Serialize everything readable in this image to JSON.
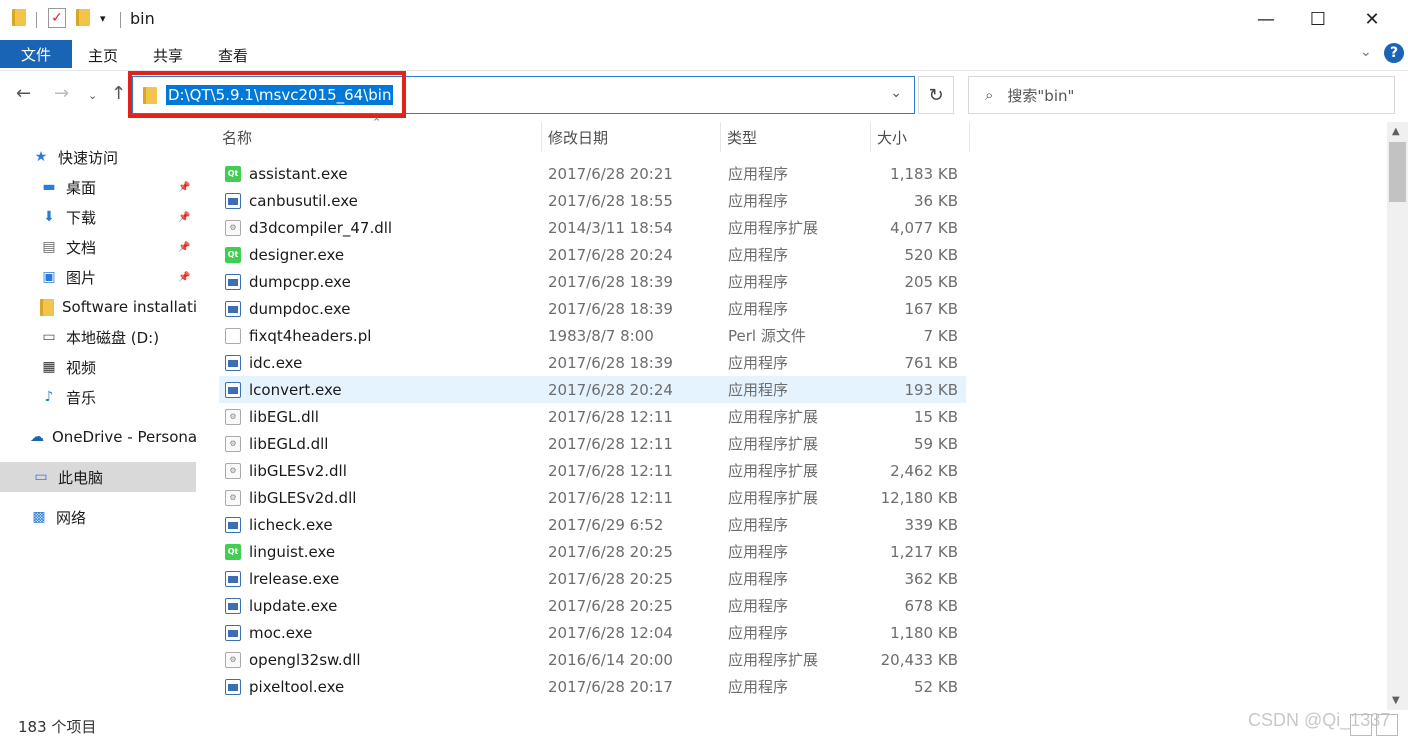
{
  "window": {
    "title": "bin",
    "minimize": "—",
    "maximize": "☐",
    "close": "✕"
  },
  "ribbon": {
    "tabs": [
      "文件",
      "主页",
      "共享",
      "查看"
    ],
    "help": "?"
  },
  "address": {
    "path": "D:\\QT\\5.9.1\\msvc2015_64\\bin",
    "search_placeholder": "搜索\"bin\""
  },
  "sidebar": {
    "items": [
      {
        "label": "快速访问",
        "icon": "star-icon"
      },
      {
        "label": "桌面",
        "icon": "desktop-icon",
        "pinned": true
      },
      {
        "label": "下载",
        "icon": "download-icon",
        "pinned": true
      },
      {
        "label": "文档",
        "icon": "document-icon",
        "pinned": true
      },
      {
        "label": "图片",
        "icon": "picture-icon",
        "pinned": true
      },
      {
        "label": "Software installati",
        "icon": "folder-icon"
      },
      {
        "label": "本地磁盘 (D:)",
        "icon": "drive-icon"
      },
      {
        "label": "视频",
        "icon": "video-icon"
      },
      {
        "label": "音乐",
        "icon": "music-icon"
      },
      {
        "label": "OneDrive - Persona",
        "icon": "cloud-icon"
      },
      {
        "label": "此电脑",
        "icon": "computer-icon",
        "selected": true
      },
      {
        "label": "网络",
        "icon": "network-icon"
      }
    ]
  },
  "columns": {
    "name": "名称",
    "date": "修改日期",
    "type": "类型",
    "size": "大小"
  },
  "files": [
    {
      "name": "assistant.exe",
      "date": "2017/6/28 20:21",
      "type": "应用程序",
      "size": "1,183 KB",
      "icon": "qt"
    },
    {
      "name": "canbusutil.exe",
      "date": "2017/6/28 18:55",
      "type": "应用程序",
      "size": "36 KB",
      "icon": "exe"
    },
    {
      "name": "d3dcompiler_47.dll",
      "date": "2014/3/11 18:54",
      "type": "应用程序扩展",
      "size": "4,077 KB",
      "icon": "dll"
    },
    {
      "name": "designer.exe",
      "date": "2017/6/28 20:24",
      "type": "应用程序",
      "size": "520 KB",
      "icon": "qt"
    },
    {
      "name": "dumpcpp.exe",
      "date": "2017/6/28 18:39",
      "type": "应用程序",
      "size": "205 KB",
      "icon": "exe"
    },
    {
      "name": "dumpdoc.exe",
      "date": "2017/6/28 18:39",
      "type": "应用程序",
      "size": "167 KB",
      "icon": "exe"
    },
    {
      "name": "fixqt4headers.pl",
      "date": "1983/8/7 8:00",
      "type": "Perl 源文件",
      "size": "7 KB",
      "icon": "pl"
    },
    {
      "name": "idc.exe",
      "date": "2017/6/28 18:39",
      "type": "应用程序",
      "size": "761 KB",
      "icon": "exe"
    },
    {
      "name": "lconvert.exe",
      "date": "2017/6/28 20:24",
      "type": "应用程序",
      "size": "193 KB",
      "icon": "exe",
      "highlight": true
    },
    {
      "name": "libEGL.dll",
      "date": "2017/6/28 12:11",
      "type": "应用程序扩展",
      "size": "15 KB",
      "icon": "dll"
    },
    {
      "name": "libEGLd.dll",
      "date": "2017/6/28 12:11",
      "type": "应用程序扩展",
      "size": "59 KB",
      "icon": "dll"
    },
    {
      "name": "libGLESv2.dll",
      "date": "2017/6/28 12:11",
      "type": "应用程序扩展",
      "size": "2,462 KB",
      "icon": "dll"
    },
    {
      "name": "libGLESv2d.dll",
      "date": "2017/6/28 12:11",
      "type": "应用程序扩展",
      "size": "12,180 KB",
      "icon": "dll"
    },
    {
      "name": "licheck.exe",
      "date": "2017/6/29 6:52",
      "type": "应用程序",
      "size": "339 KB",
      "icon": "exe"
    },
    {
      "name": "linguist.exe",
      "date": "2017/6/28 20:25",
      "type": "应用程序",
      "size": "1,217 KB",
      "icon": "qt"
    },
    {
      "name": "lrelease.exe",
      "date": "2017/6/28 20:25",
      "type": "应用程序",
      "size": "362 KB",
      "icon": "exe"
    },
    {
      "name": "lupdate.exe",
      "date": "2017/6/28 20:25",
      "type": "应用程序",
      "size": "678 KB",
      "icon": "exe"
    },
    {
      "name": "moc.exe",
      "date": "2017/6/28 12:04",
      "type": "应用程序",
      "size": "1,180 KB",
      "icon": "exe"
    },
    {
      "name": "opengl32sw.dll",
      "date": "2016/6/14 20:00",
      "type": "应用程序扩展",
      "size": "20,433 KB",
      "icon": "dll"
    },
    {
      "name": "pixeltool.exe",
      "date": "2017/6/28 20:17",
      "type": "应用程序",
      "size": "52 KB",
      "icon": "exe"
    }
  ],
  "status": {
    "count": "183 个项目"
  },
  "watermark": "CSDN @Qi_1337",
  "colors": {
    "accent": "#1a64b6",
    "selection": "#0078d7",
    "highlight_row": "#e5f3ff",
    "annotation_box": "#e2231a"
  }
}
